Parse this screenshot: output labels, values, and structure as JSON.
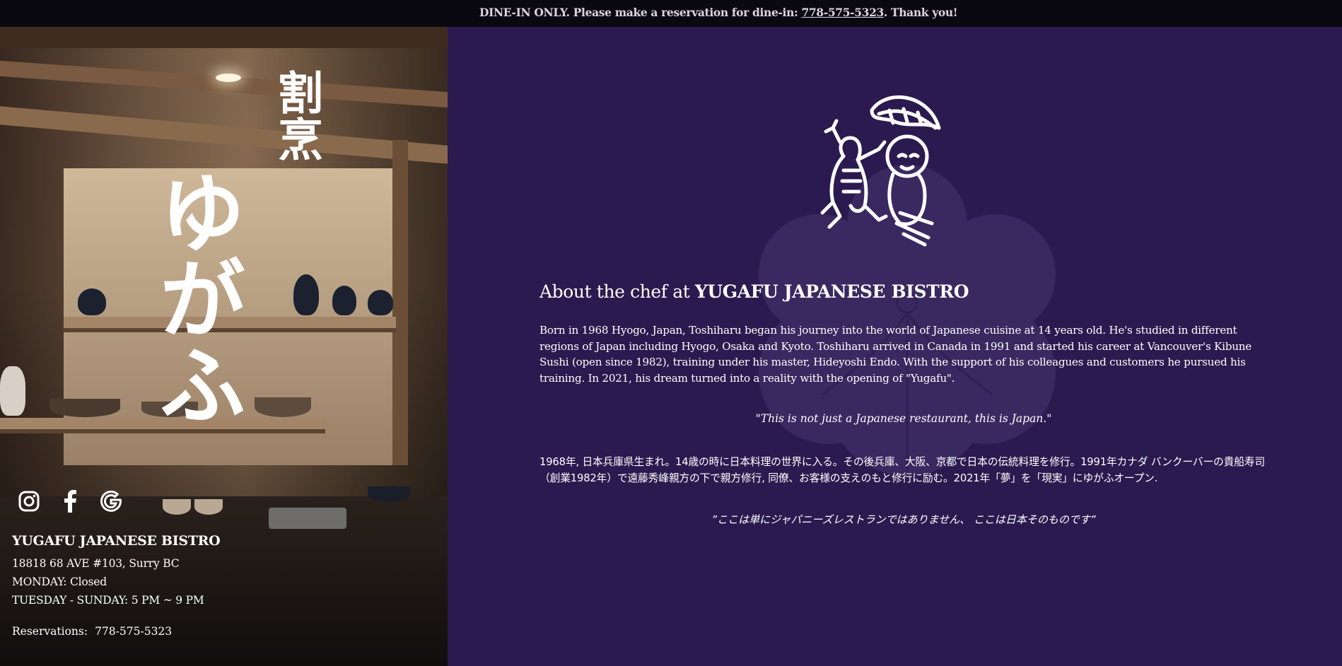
{
  "announcement": {
    "text_before": "DINE-IN ONLY. Please make a reservation for dine-in: ",
    "phone": "778-575-5323",
    "text_after": ". Thank you!"
  },
  "hero": {
    "kappo": "割烹",
    "yugafu": "ゆがふ"
  },
  "social": [
    {
      "icon": "instagram-icon"
    },
    {
      "icon": "facebook-icon"
    },
    {
      "icon": "google-icon"
    }
  ],
  "restaurant": {
    "name": "YUGAFU JAPANESE BISTRO",
    "address": "18818 68 AVE #103, Surry BC",
    "hours_monday": "MONDAY: Closed",
    "hours_week": "TUESDAY - SUNDAY: 5 PM ~ 9 PM",
    "reservations_label": "Reservations:",
    "reservations_phone": "778-575-5323"
  },
  "about": {
    "title_prefix": "About the chef at ",
    "title_bold": "YUGAFU JAPANESE BISTRO",
    "bio_en": "Born in 1968 Hyogo, Japan, Toshiharu began his journey into the world of Japanese cuisine at 14 years old. He's studied in different regions of Japan including Hyogo, Osaka and Kyoto. Toshiharu arrived in Canada in 1991 and started his career at Vancouver's Kibune Sushi (open since 1982), training under his master, Hideyoshi Endo. With the support of his colleagues and customers he pursued his training. In 2021, his dream turned into a reality with the opening of \"Yugafu\".",
    "quote_en": "\"This is not just a Japanese restaurant, this is Japan.\"",
    "bio_jp": "1968年, 日本兵庫県生まれ。14歳の時に日本料理の世界に入る。その後兵庫、大阪、京都で日本の伝統料理を修行。1991年カナダ バンクーバーの貴船寿司（創業1982年）で遠藤秀峰親方の下で親方修行, 同僚、お客様の支えのもと修行に励む。2021年「夢」を「現実」にゆがふオープン.",
    "quote_jp": "”ここは単にジャパニーズレストランではありません、 ここは日本そのものです”"
  },
  "colors": {
    "panel_bg": "#2b1a4f",
    "topbar_bg": "#0b0910",
    "crest": "#3d2b62"
  }
}
